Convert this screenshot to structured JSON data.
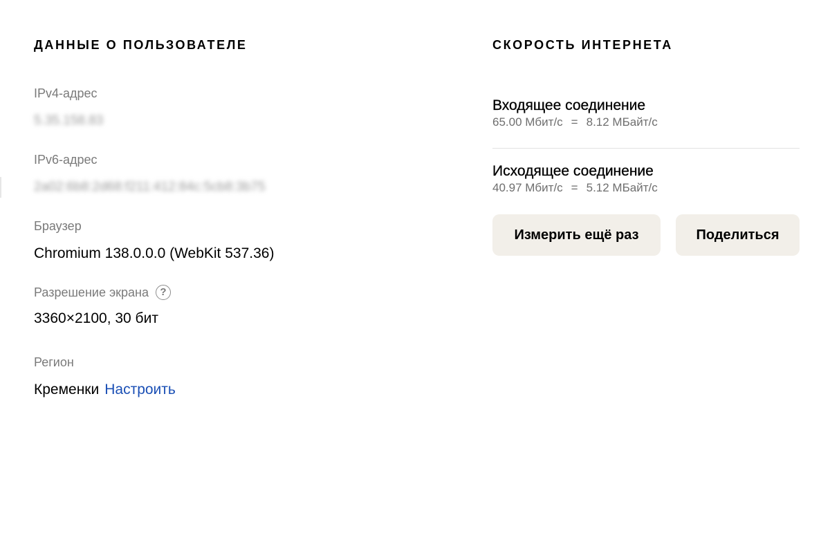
{
  "user_info": {
    "title": "ДАННЫЕ О ПОЛЬЗОВАТЕЛЕ",
    "ipv4": {
      "label": "IPv4-адрес",
      "value": "5.35.158.83"
    },
    "ipv6": {
      "label": "IPv6-адрес",
      "value": "2a02:6b8:2d68:f211:412:84c:5cb8:3b75"
    },
    "browser": {
      "label": "Браузер",
      "value": "Chromium 138.0.0.0 (WebKit 537.36)"
    },
    "screen": {
      "label": "Разрешение экрана",
      "value": "3360×2100, 30 бит",
      "help_icon": "?"
    },
    "region": {
      "label": "Регион",
      "value": "Кременки",
      "link": "Настроить"
    }
  },
  "speed": {
    "title": "СКОРОСТЬ ИНТЕРНЕТА",
    "incoming": {
      "title": "Входящее соединение",
      "mbit": "65.00 Мбит/с",
      "eq": "=",
      "mbyte": "8.12 МБайт/с"
    },
    "outgoing": {
      "title": "Исходящее соединение",
      "mbit": "40.97 Мбит/с",
      "eq": "=",
      "mbyte": "5.12 МБайт/с"
    },
    "measure_button": "Измерить ещё раз",
    "share_button": "Поделиться"
  },
  "colors": {
    "link": "#1a4fb5",
    "button_bg": "#f2efe9",
    "label_gray": "#7a7a7a"
  }
}
